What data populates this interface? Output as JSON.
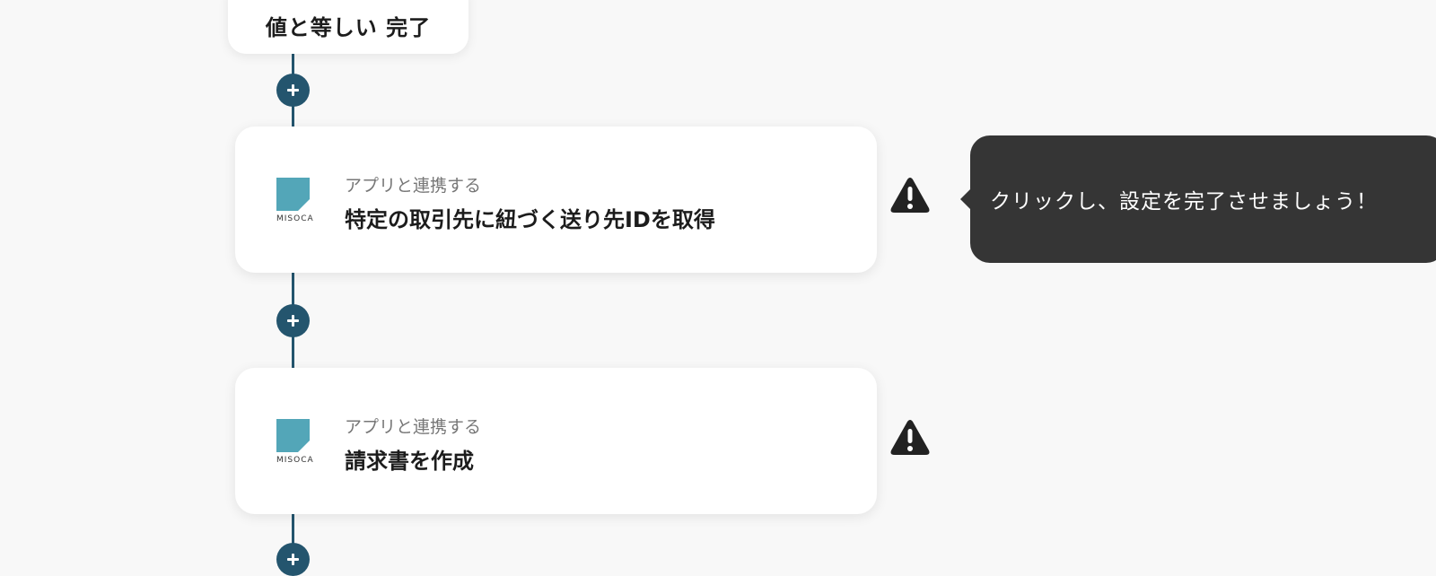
{
  "flow": {
    "previous_step": {
      "label": "値と等しい 完了"
    },
    "steps": [
      {
        "app": "Misoca",
        "app_logo_text": "MISOCA",
        "type_label": "アプリと連携する",
        "title": "特定の取引先に紐づく送り先IDを取得",
        "warning_icon": "warning-triangle-icon"
      },
      {
        "app": "Misoca",
        "app_logo_text": "MISOCA",
        "type_label": "アプリと連携する",
        "title": "請求書を作成",
        "warning_icon": "warning-triangle-icon"
      }
    ],
    "add_button_icon": "plus-icon"
  },
  "tooltip": {
    "text": "クリックし、設定を完了させましょう！"
  },
  "colors": {
    "background": "#f8f8f8",
    "flow_line": "#24556e",
    "misoca_brand": "#53a6b8",
    "tooltip_bg": "#353535",
    "warning": "#222222"
  }
}
